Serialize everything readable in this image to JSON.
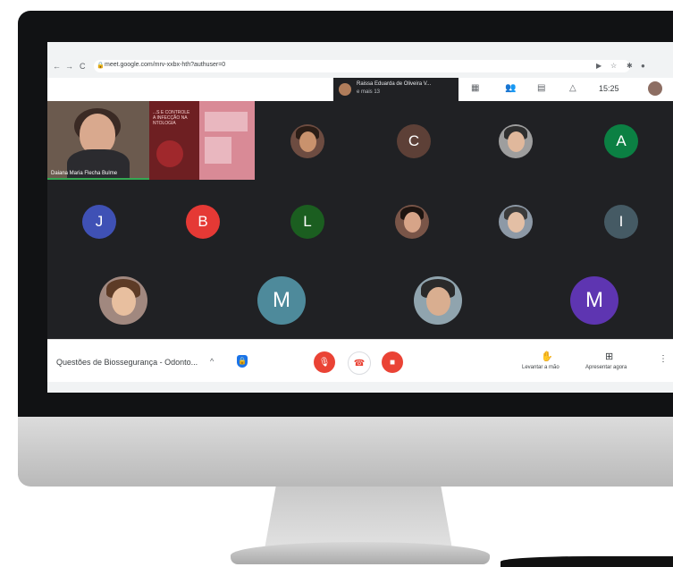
{
  "browser": {
    "url": "meet.google.com/mrv-xxbx-hth?authuser=0",
    "nav_back": "←",
    "nav_forward": "→",
    "nav_reload": "C"
  },
  "meet_top": {
    "presenter_name": "Raissa Eduarda de Oliveira V...",
    "presenter_more": "e mais 13",
    "time": "15:25"
  },
  "tiles": {
    "cam_name": "Daiana Maria Flecha Bulme",
    "slide_text": "...S E CONTROLE\nA INFECÇÃO NA\nNTOLOGIA"
  },
  "participants": {
    "row1": [
      {
        "type": "photo",
        "name": "participant-photo-1"
      },
      {
        "type": "letter",
        "letter": "C",
        "color": "#5d4037"
      },
      {
        "type": "photo",
        "name": "participant-photo-2"
      },
      {
        "type": "letter",
        "letter": "A",
        "color": "#0b8043"
      }
    ],
    "row2": [
      {
        "type": "letter",
        "letter": "J",
        "color": "#3f51b5"
      },
      {
        "type": "letter",
        "letter": "B",
        "color": "#e53935"
      },
      {
        "type": "letter",
        "letter": "L",
        "color": "#1b5e20"
      },
      {
        "type": "photo",
        "name": "participant-photo-3"
      },
      {
        "type": "photo",
        "name": "participant-photo-4"
      },
      {
        "type": "letter",
        "letter": "I",
        "color": "#455a64"
      }
    ],
    "row3": [
      {
        "type": "photo",
        "name": "participant-photo-5"
      },
      {
        "type": "letter",
        "letter": "M",
        "color": "#4e8a9b"
      },
      {
        "type": "photo",
        "name": "participant-photo-6"
      },
      {
        "type": "letter",
        "letter": "M",
        "color": "#5e35b1"
      }
    ]
  },
  "controls": {
    "meeting_title": "Questões de Biossegurança - Odonto...",
    "caret": "^",
    "raise_hand_label": "Levantar a mão",
    "present_label": "Apresentar agora",
    "more_dots": "⋮"
  },
  "colors": {
    "meet_bg": "#202124",
    "red_control": "#ea4335",
    "accent_blue": "#1a73e8"
  }
}
